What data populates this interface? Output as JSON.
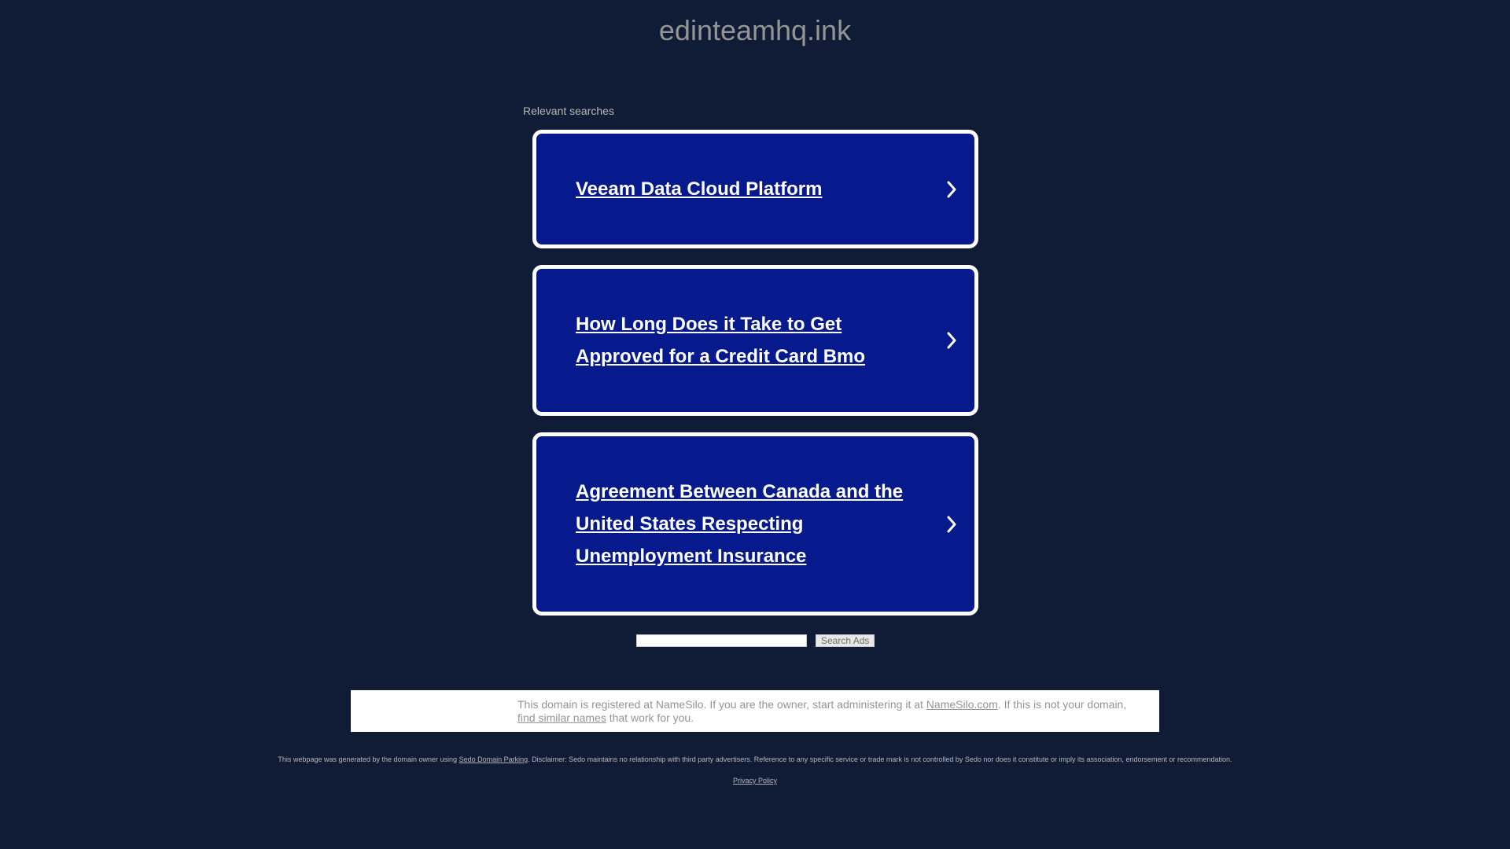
{
  "header": {
    "domain": "edinteamhq.ink"
  },
  "searches": {
    "label": "Relevant searches",
    "items": [
      {
        "label": "Veeam Data Cloud Platform"
      },
      {
        "label": "How Long Does it Take to Get Approved for a Credit Card Bmo"
      },
      {
        "label": "Agreement Between Canada and the United States Respecting Unemployment Insurance"
      }
    ]
  },
  "search_form": {
    "input_value": "",
    "button_label": "Search Ads"
  },
  "notice": {
    "text_1": "This domain is registered at NameSilo. If you are the owner, start administering it at ",
    "link_1": "NameSilo.com",
    "text_2": ". If this is not your domain, ",
    "link_2": "find similar names",
    "text_3": " that work for you."
  },
  "footer": {
    "disclaimer_1": "This webpage was generated by the domain owner using ",
    "disclaimer_link": "Sedo Domain Parking",
    "disclaimer_2": ". Disclaimer: Sedo maintains no relationship with third party advertisers. Reference to any specific service or trade mark is not controlled by Sedo nor does it constitute or imply its association, endorsement or recommendation.",
    "privacy_label": "Privacy Policy"
  },
  "colors": {
    "background": "#101c36",
    "card_background": "#061a8d",
    "card_border": "#ffffff",
    "muted_text": "#949494"
  }
}
